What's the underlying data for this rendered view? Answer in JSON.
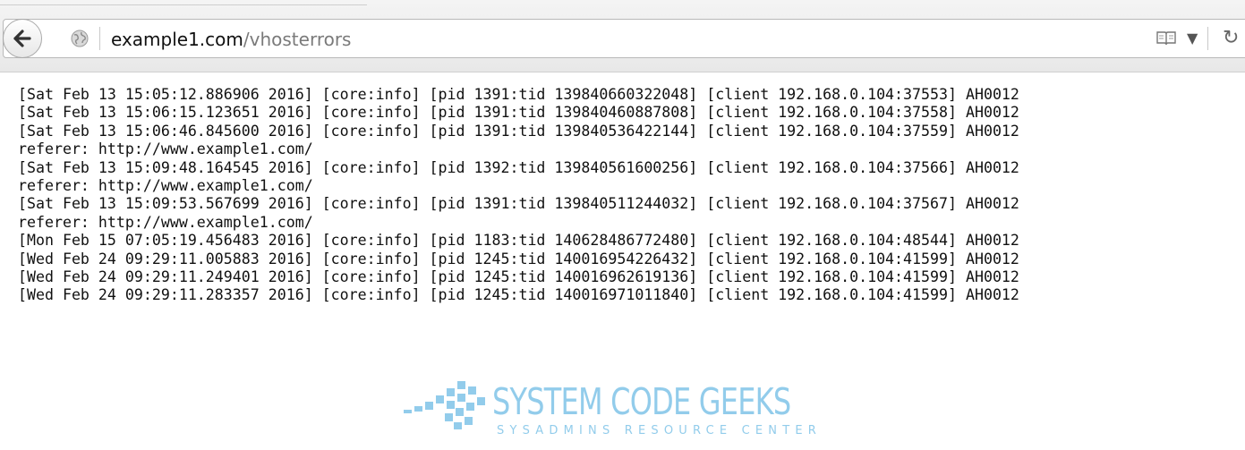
{
  "browser": {
    "url_domain": "example1.com",
    "url_path": "/vhosterrors",
    "icons": {
      "back": "back-arrow-icon",
      "site": "globe-icon",
      "reader": "reader-view-icon",
      "dropdown": "dropdown-arrow-icon",
      "reload": "reload-icon"
    }
  },
  "log_lines": [
    "[Sat Feb 13 15:05:12.886906 2016] [core:info] [pid 1391:tid 139840660322048] [client 192.168.0.104:37553] AH0012",
    "[Sat Feb 13 15:06:15.123651 2016] [core:info] [pid 1391:tid 139840460887808] [client 192.168.0.104:37558] AH0012",
    "[Sat Feb 13 15:06:46.845600 2016] [core:info] [pid 1391:tid 139840536422144] [client 192.168.0.104:37559] AH0012",
    "referer: http://www.example1.com/",
    "[Sat Feb 13 15:09:48.164545 2016] [core:info] [pid 1392:tid 139840561600256] [client 192.168.0.104:37566] AH0012",
    "referer: http://www.example1.com/",
    "[Sat Feb 13 15:09:53.567699 2016] [core:info] [pid 1391:tid 139840511244032] [client 192.168.0.104:37567] AH0012",
    "referer: http://www.example1.com/",
    "[Mon Feb 15 07:05:19.456483 2016] [core:info] [pid 1183:tid 140628486772480] [client 192.168.0.104:48544] AH0012",
    "[Wed Feb 24 09:29:11.005883 2016] [core:info] [pid 1245:tid 140016954226432] [client 192.168.0.104:41599] AH0012",
    "[Wed Feb 24 09:29:11.249401 2016] [core:info] [pid 1245:tid 140016962619136] [client 192.168.0.104:41599] AH0012",
    "[Wed Feb 24 09:29:11.283357 2016] [core:info] [pid 1245:tid 140016971011840] [client 192.168.0.104:41599] AH0012"
  ],
  "watermark": {
    "title": "SYSTEM CODE GEEKS",
    "subtitle": "SYSADMINS RESOURCE CENTER",
    "color": "#7fc4e8"
  }
}
